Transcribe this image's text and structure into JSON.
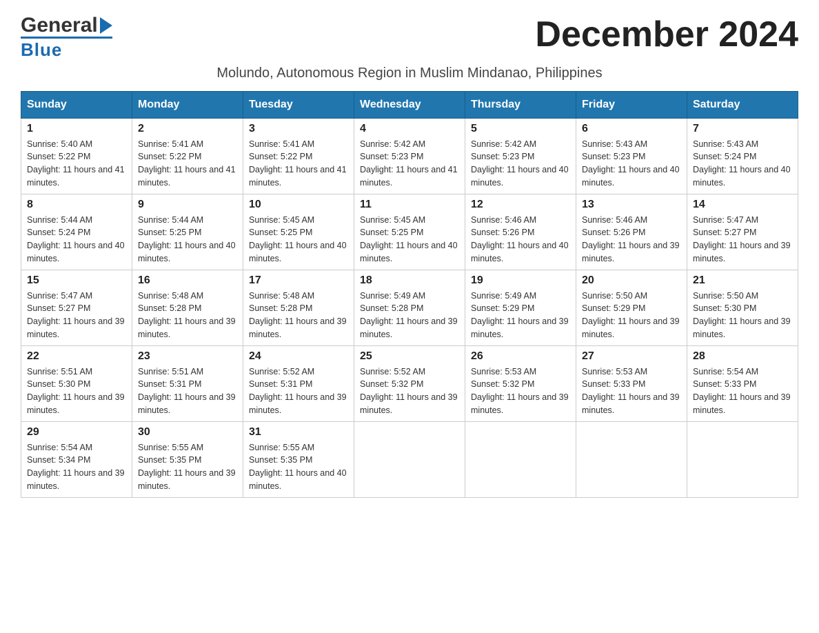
{
  "header": {
    "title": "December 2024",
    "subtitle": "Molundo, Autonomous Region in Muslim Mindanao, Philippines",
    "logo_general": "General",
    "logo_blue": "Blue"
  },
  "days_of_week": [
    "Sunday",
    "Monday",
    "Tuesday",
    "Wednesday",
    "Thursday",
    "Friday",
    "Saturday"
  ],
  "weeks": [
    [
      {
        "day": "1",
        "sunrise": "5:40 AM",
        "sunset": "5:22 PM",
        "daylight": "11 hours and 41 minutes."
      },
      {
        "day": "2",
        "sunrise": "5:41 AM",
        "sunset": "5:22 PM",
        "daylight": "11 hours and 41 minutes."
      },
      {
        "day": "3",
        "sunrise": "5:41 AM",
        "sunset": "5:22 PM",
        "daylight": "11 hours and 41 minutes."
      },
      {
        "day": "4",
        "sunrise": "5:42 AM",
        "sunset": "5:23 PM",
        "daylight": "11 hours and 41 minutes."
      },
      {
        "day": "5",
        "sunrise": "5:42 AM",
        "sunset": "5:23 PM",
        "daylight": "11 hours and 40 minutes."
      },
      {
        "day": "6",
        "sunrise": "5:43 AM",
        "sunset": "5:23 PM",
        "daylight": "11 hours and 40 minutes."
      },
      {
        "day": "7",
        "sunrise": "5:43 AM",
        "sunset": "5:24 PM",
        "daylight": "11 hours and 40 minutes."
      }
    ],
    [
      {
        "day": "8",
        "sunrise": "5:44 AM",
        "sunset": "5:24 PM",
        "daylight": "11 hours and 40 minutes."
      },
      {
        "day": "9",
        "sunrise": "5:44 AM",
        "sunset": "5:25 PM",
        "daylight": "11 hours and 40 minutes."
      },
      {
        "day": "10",
        "sunrise": "5:45 AM",
        "sunset": "5:25 PM",
        "daylight": "11 hours and 40 minutes."
      },
      {
        "day": "11",
        "sunrise": "5:45 AM",
        "sunset": "5:25 PM",
        "daylight": "11 hours and 40 minutes."
      },
      {
        "day": "12",
        "sunrise": "5:46 AM",
        "sunset": "5:26 PM",
        "daylight": "11 hours and 40 minutes."
      },
      {
        "day": "13",
        "sunrise": "5:46 AM",
        "sunset": "5:26 PM",
        "daylight": "11 hours and 39 minutes."
      },
      {
        "day": "14",
        "sunrise": "5:47 AM",
        "sunset": "5:27 PM",
        "daylight": "11 hours and 39 minutes."
      }
    ],
    [
      {
        "day": "15",
        "sunrise": "5:47 AM",
        "sunset": "5:27 PM",
        "daylight": "11 hours and 39 minutes."
      },
      {
        "day": "16",
        "sunrise": "5:48 AM",
        "sunset": "5:28 PM",
        "daylight": "11 hours and 39 minutes."
      },
      {
        "day": "17",
        "sunrise": "5:48 AM",
        "sunset": "5:28 PM",
        "daylight": "11 hours and 39 minutes."
      },
      {
        "day": "18",
        "sunrise": "5:49 AM",
        "sunset": "5:28 PM",
        "daylight": "11 hours and 39 minutes."
      },
      {
        "day": "19",
        "sunrise": "5:49 AM",
        "sunset": "5:29 PM",
        "daylight": "11 hours and 39 minutes."
      },
      {
        "day": "20",
        "sunrise": "5:50 AM",
        "sunset": "5:29 PM",
        "daylight": "11 hours and 39 minutes."
      },
      {
        "day": "21",
        "sunrise": "5:50 AM",
        "sunset": "5:30 PM",
        "daylight": "11 hours and 39 minutes."
      }
    ],
    [
      {
        "day": "22",
        "sunrise": "5:51 AM",
        "sunset": "5:30 PM",
        "daylight": "11 hours and 39 minutes."
      },
      {
        "day": "23",
        "sunrise": "5:51 AM",
        "sunset": "5:31 PM",
        "daylight": "11 hours and 39 minutes."
      },
      {
        "day": "24",
        "sunrise": "5:52 AM",
        "sunset": "5:31 PM",
        "daylight": "11 hours and 39 minutes."
      },
      {
        "day": "25",
        "sunrise": "5:52 AM",
        "sunset": "5:32 PM",
        "daylight": "11 hours and 39 minutes."
      },
      {
        "day": "26",
        "sunrise": "5:53 AM",
        "sunset": "5:32 PM",
        "daylight": "11 hours and 39 minutes."
      },
      {
        "day": "27",
        "sunrise": "5:53 AM",
        "sunset": "5:33 PM",
        "daylight": "11 hours and 39 minutes."
      },
      {
        "day": "28",
        "sunrise": "5:54 AM",
        "sunset": "5:33 PM",
        "daylight": "11 hours and 39 minutes."
      }
    ],
    [
      {
        "day": "29",
        "sunrise": "5:54 AM",
        "sunset": "5:34 PM",
        "daylight": "11 hours and 39 minutes."
      },
      {
        "day": "30",
        "sunrise": "5:55 AM",
        "sunset": "5:35 PM",
        "daylight": "11 hours and 39 minutes."
      },
      {
        "day": "31",
        "sunrise": "5:55 AM",
        "sunset": "5:35 PM",
        "daylight": "11 hours and 40 minutes."
      },
      null,
      null,
      null,
      null
    ]
  ]
}
